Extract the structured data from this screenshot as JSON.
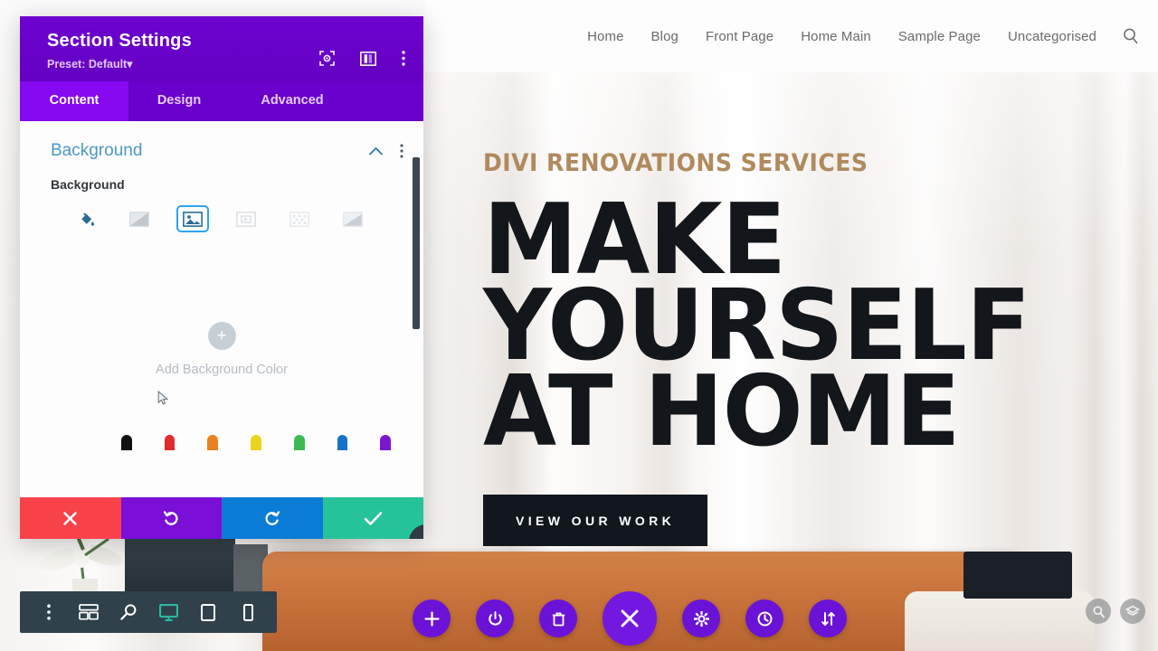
{
  "site": {
    "nav": {
      "items": [
        {
          "label": "Home"
        },
        {
          "label": "Blog"
        },
        {
          "label": "Front Page"
        },
        {
          "label": "Home Main"
        },
        {
          "label": "Sample Page"
        },
        {
          "label": "Uncategorised"
        }
      ],
      "search_icon": "search-icon"
    },
    "hero": {
      "eyebrow": "DIVI RENOVATIONS SERVICES",
      "headline_line1": "MAKE YOURSELF",
      "headline_line2": "AT HOME",
      "cta_label": "VIEW OUR WORK",
      "eyebrow_color": "#b08a5e",
      "headline_color": "#13161a",
      "cta_bg": "#12171e"
    }
  },
  "panel": {
    "title": "Section Settings",
    "preset": "Preset: Default",
    "preset_caret": "▾",
    "header_icons": [
      {
        "name": "focus-target-icon"
      },
      {
        "name": "panel-layout-icon"
      },
      {
        "name": "kebab-menu-icon"
      }
    ],
    "tabs": [
      {
        "label": "Content",
        "active": true
      },
      {
        "label": "Design",
        "active": false
      },
      {
        "label": "Advanced",
        "active": false
      }
    ],
    "accent_purple": "#6a00cc",
    "active_tab_purple": "#8609f1",
    "section": {
      "title": "Background",
      "collapse_icon": "chevron-up-icon",
      "options_icon": "kebab-menu-icon",
      "field_label": "Background",
      "bg_types": [
        {
          "name": "background-color-icon",
          "selected": false,
          "active_color": true
        },
        {
          "name": "background-gradient-icon",
          "selected": false,
          "active_color": false
        },
        {
          "name": "background-image-icon",
          "selected": true,
          "active_color": false
        },
        {
          "name": "background-video-icon",
          "selected": false,
          "active_color": false
        },
        {
          "name": "background-pattern-icon",
          "selected": false,
          "active_color": false
        },
        {
          "name": "background-mask-icon",
          "selected": false,
          "active_color": false
        }
      ],
      "empty_state": {
        "add_icon": "+",
        "label": "Add Background Color"
      }
    },
    "swatches": [
      "#111111",
      "#e02b2b",
      "#e8811e",
      "#ead41c",
      "#3cba54",
      "#1573c6",
      "#7a18cf"
    ],
    "actions": [
      {
        "name": "discard-changes-button",
        "icon": "close-icon",
        "color": "#f9414a"
      },
      {
        "name": "undo-button",
        "icon": "undo-icon",
        "color": "#7a0fd8"
      },
      {
        "name": "redo-button",
        "icon": "redo-icon",
        "color": "#0b7cd6"
      },
      {
        "name": "save-changes-button",
        "icon": "check-icon",
        "color": "#26c39a"
      }
    ],
    "resize_handle": "resize-handle-icon"
  },
  "responsive_toolbar": {
    "buttons": [
      {
        "name": "more-options-icon",
        "active": false
      },
      {
        "name": "wireframe-view-icon",
        "active": false
      },
      {
        "name": "zoom-out-view-icon",
        "active": false
      },
      {
        "name": "desktop-view-icon",
        "active": true
      },
      {
        "name": "tablet-view-icon",
        "active": false
      },
      {
        "name": "phone-view-icon",
        "active": false
      }
    ],
    "active_color": "#2bb99b",
    "background": "#30414b"
  },
  "divi_menu": {
    "buttons": [
      {
        "name": "add-section-button",
        "icon": "plus-icon"
      },
      {
        "name": "toggle-builder-button",
        "icon": "power-icon"
      },
      {
        "name": "trash-button",
        "icon": "trash-icon"
      },
      {
        "name": "close-menu-button",
        "icon": "close-icon",
        "main": true
      },
      {
        "name": "settings-button",
        "icon": "gear-icon"
      },
      {
        "name": "history-button",
        "icon": "clock-icon"
      },
      {
        "name": "portability-button",
        "icon": "sort-arrows-icon"
      }
    ],
    "color": "#6a13d6"
  },
  "bottom_right_icons": [
    {
      "name": "zoom-icon"
    },
    {
      "name": "layers-icon"
    }
  ]
}
